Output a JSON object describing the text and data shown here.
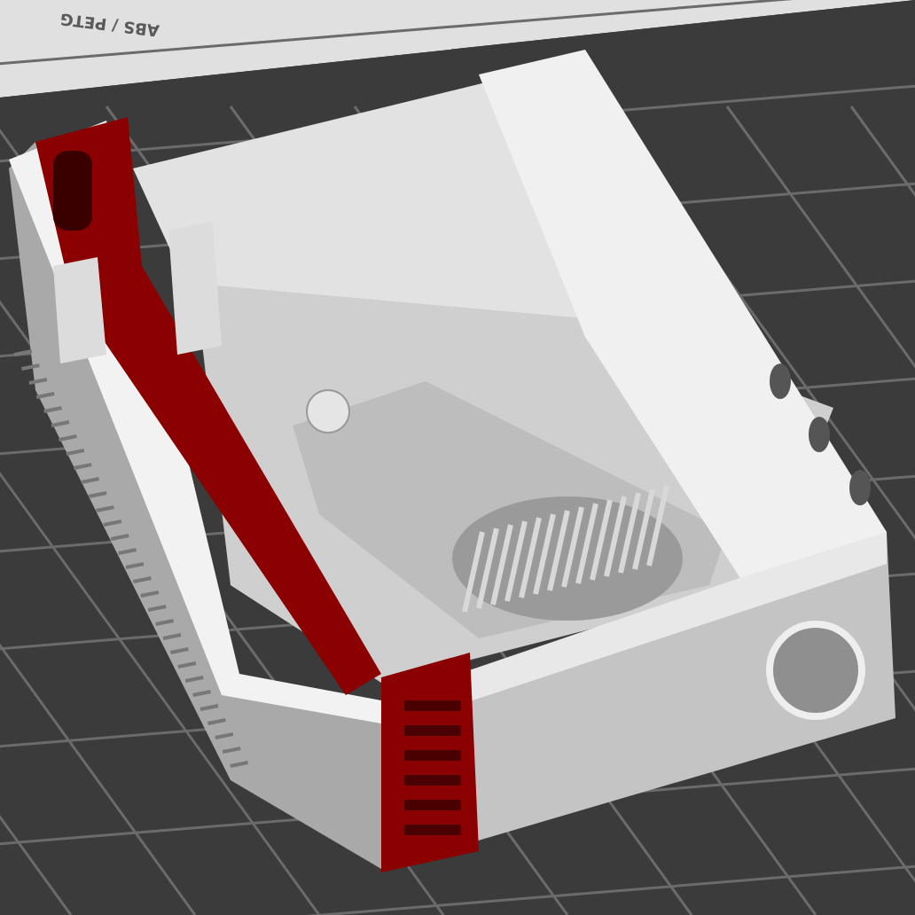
{
  "bed": {
    "label": "ABS / PETG"
  }
}
